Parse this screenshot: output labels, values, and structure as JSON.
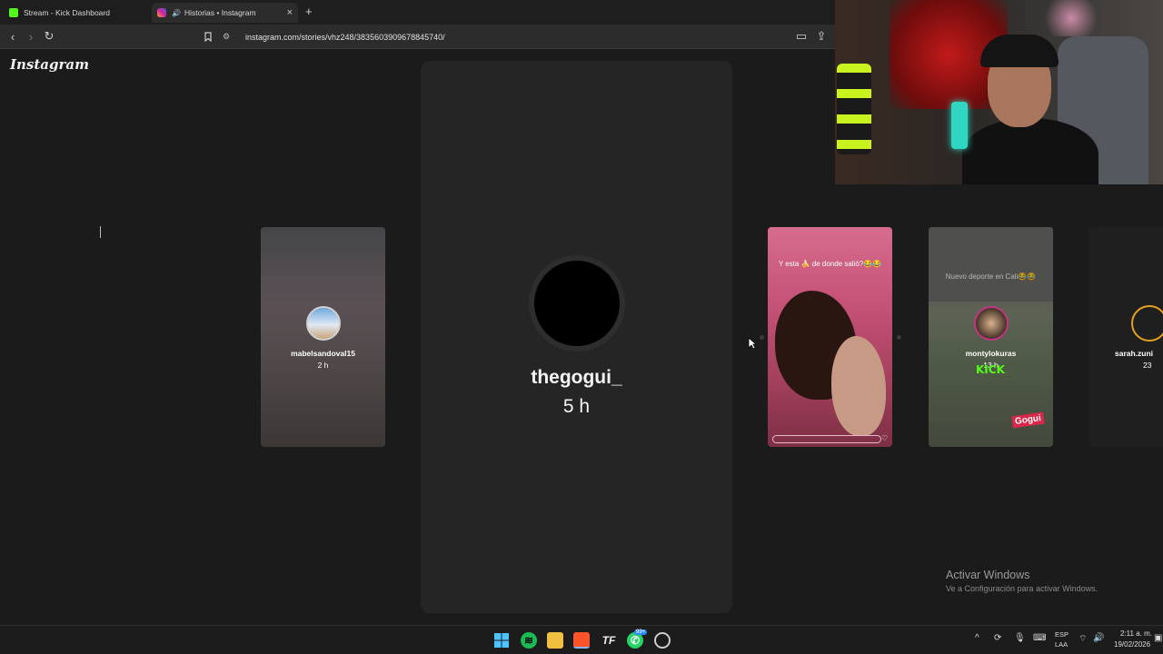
{
  "browser": {
    "tabs": [
      {
        "title": "Stream - Kick Dashboard",
        "active": false,
        "favicon_color": "#53fc18"
      },
      {
        "title": "Historias • Instagram",
        "active": true,
        "favicon_color": "#d6249f"
      }
    ],
    "new_tab_glyph": "+",
    "address": "instagram.com/stories/vhz248/3835603909678845740/"
  },
  "page": {
    "logo": "Instagram",
    "center_story": {
      "username": "thegogui_",
      "time": "5 h"
    },
    "stories": [
      {
        "username": "mabelsandoval15",
        "time": "2 h"
      },
      {
        "caption": "Y esta 🍌 de donde salió?😂😂"
      },
      {
        "username": "montylokuras",
        "time": "13 h",
        "caption": "Nuevo deporte en Cali😂😂",
        "overlay_text": "KICK",
        "brand_text": "Gogui"
      },
      {
        "username": "sarah.zuni",
        "time": "23"
      }
    ],
    "watermark": {
      "title": "Activar Windows",
      "subtitle": "Ve a Configuración para activar Windows."
    }
  },
  "taskbar": {
    "whatsapp_badge": "99+",
    "language": "ESP",
    "keyboard": "LAA",
    "time": "2:11 a. m.",
    "date": "19/02/2026"
  }
}
